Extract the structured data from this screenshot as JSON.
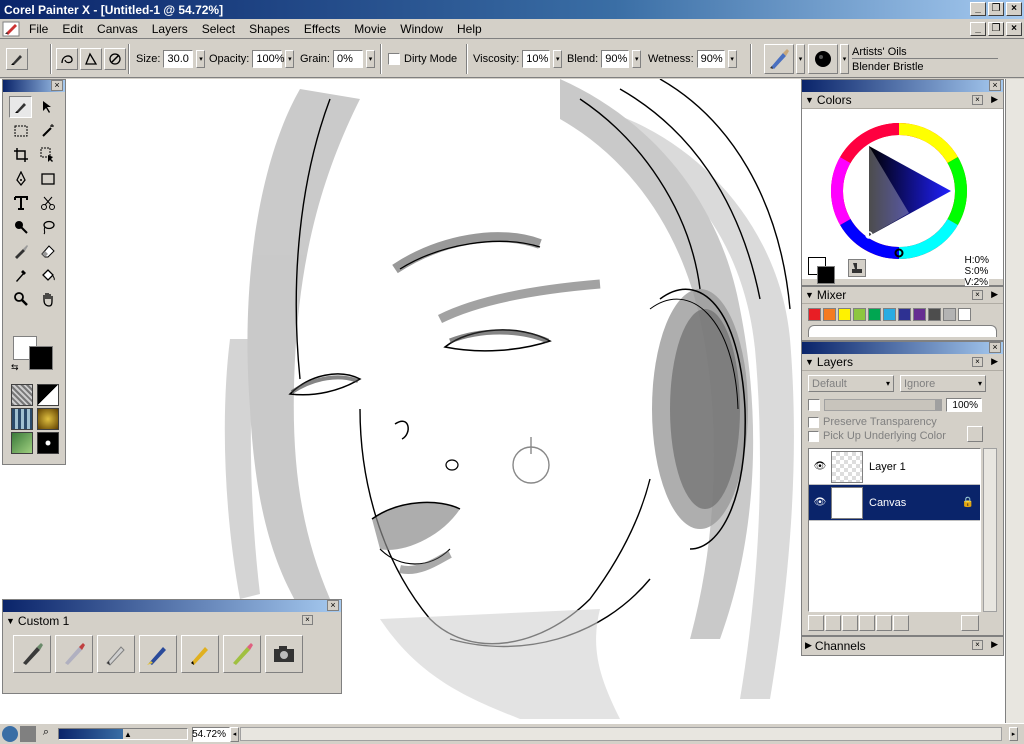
{
  "window": {
    "title": "Corel Painter X - [Untitled-1 @ 54.72%]"
  },
  "menu": [
    "File",
    "Edit",
    "Canvas",
    "Layers",
    "Select",
    "Shapes",
    "Effects",
    "Movie",
    "Window",
    "Help"
  ],
  "property_bar": {
    "size_label": "Size:",
    "size_value": "30.0",
    "opacity_label": "Opacity:",
    "opacity_value": "100%",
    "grain_label": "Grain:",
    "grain_value": "0%",
    "dirty_mode_label": "Dirty Mode",
    "dirty_mode_checked": false,
    "viscosity_label": "Viscosity:",
    "viscosity_value": "10%",
    "blend_label": "Blend:",
    "blend_value": "90%",
    "wetness_label": "Wetness:",
    "wetness_value": "90%",
    "brush_category": "Artists' Oils",
    "brush_variant": "Blender Bristle"
  },
  "toolbox": {
    "tools": [
      "brush-icon",
      "layer-adjuster-icon",
      "rectangular-selection-icon",
      "magic-wand-icon",
      "crop-icon",
      "selection-adjuster-icon",
      "pen-icon",
      "rectangle-shape-icon",
      "text-icon",
      "scissors-icon",
      "dodge-icon",
      "lasso-icon",
      "cloner-icon",
      "eraser-icon",
      "dropper-icon",
      "paint-bucket-icon",
      "magnifier-icon",
      "grabber-icon"
    ]
  },
  "custom_palette": {
    "title": "Custom  1",
    "buttons": [
      "oil-brush-icon",
      "blender-icon",
      "pencil-icon",
      "palette-knife-icon",
      "marker-icon",
      "pastel-icon",
      "camera-icon"
    ]
  },
  "colors_panel": {
    "title": "Colors",
    "h": "H:0%",
    "s": "S:0%",
    "v": "V:2%"
  },
  "mixer_panel": {
    "title": "Mixer",
    "swatches": [
      "#e81e25",
      "#f47b20",
      "#fff200",
      "#8dc63f",
      "#00a651",
      "#29abe2",
      "#2e3192",
      "#662d91",
      "#4d4d4d",
      "#b3b3b3",
      "#ffffff"
    ]
  },
  "layers_panel": {
    "title": "Layers",
    "composite_method": "Default",
    "composite_depth": "Ignore",
    "opacity": "100%",
    "preserve_transparency": "Preserve Transparency",
    "pick_up_underlying": "Pick Up Underlying Color",
    "layers": [
      {
        "name": "Layer 1",
        "selected": false
      },
      {
        "name": "Canvas",
        "selected": true
      }
    ]
  },
  "channels_panel": {
    "title": "Channels"
  },
  "status": {
    "zoom": "54.72%"
  },
  "colors": {
    "title_blue": "#0a246a",
    "chrome": "#d4d0c8",
    "selection": "#0a246a"
  }
}
